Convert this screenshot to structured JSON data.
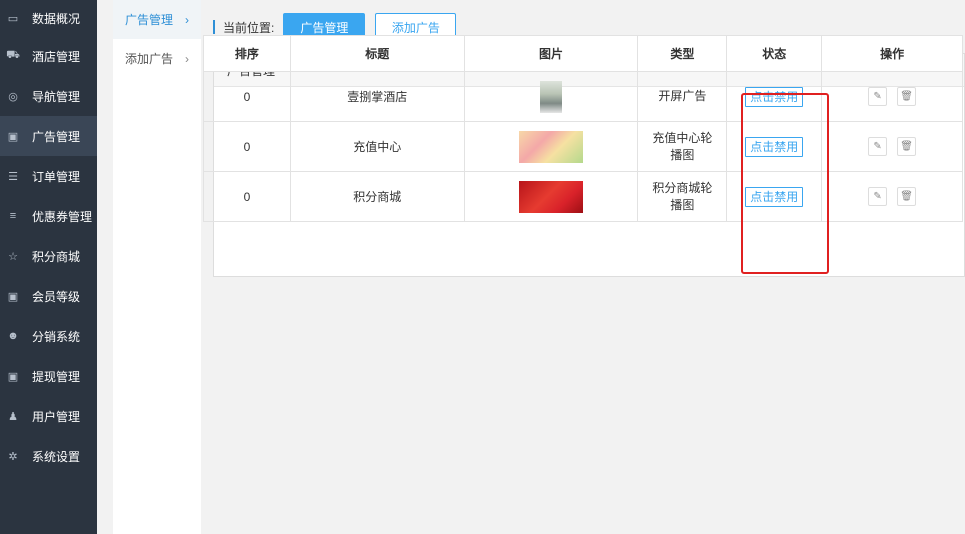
{
  "sidebar": {
    "items": [
      {
        "label": "数据概况",
        "icon": "dashboard-icon",
        "glyph": "▭"
      },
      {
        "label": "酒店管理",
        "icon": "cart-icon",
        "glyph": "⛟"
      },
      {
        "label": "导航管理",
        "icon": "compass-icon",
        "glyph": "◎"
      },
      {
        "label": "广告管理",
        "icon": "gift-icon",
        "glyph": "▣"
      },
      {
        "label": "订单管理",
        "icon": "server-icon",
        "glyph": "☰"
      },
      {
        "label": "优惠券管理",
        "icon": "list-icon",
        "glyph": "≡"
      },
      {
        "label": "积分商城",
        "icon": "star-icon",
        "glyph": "☆"
      },
      {
        "label": "会员等级",
        "icon": "money-icon",
        "glyph": "▣"
      },
      {
        "label": "分销系统",
        "icon": "users-icon",
        "glyph": "☻"
      },
      {
        "label": "提现管理",
        "icon": "cash-icon",
        "glyph": "▣"
      },
      {
        "label": "用户管理",
        "icon": "user-icon",
        "glyph": "♟"
      },
      {
        "label": "系统设置",
        "icon": "gear-icon",
        "glyph": "✲"
      }
    ],
    "active_index": 3
  },
  "submenu": {
    "items": [
      {
        "label": "广告管理"
      },
      {
        "label": "添加广告"
      }
    ]
  },
  "breadcrumb": {
    "label": "当前位置:",
    "current_button": "广告管理",
    "add_button": "添加广告"
  },
  "panel": {
    "title": "广告管理",
    "columns": [
      "排序",
      "标题",
      "图片",
      "类型",
      "状态",
      "操作"
    ],
    "rows": [
      {
        "order": "0",
        "title": "壹捌掌酒店",
        "image": "hotel-photo",
        "type": "开屏广告",
        "status": "点击禁用"
      },
      {
        "order": "0",
        "title": "充值中心",
        "image": "recharge-banner",
        "type": "充值中心轮播图",
        "status": "点击禁用"
      },
      {
        "order": "0",
        "title": "积分商城",
        "image": "points-mall-banner",
        "type": "积分商城轮播图",
        "status": "点击禁用"
      }
    ]
  },
  "colors": {
    "sidebar_bg": "#2b3440",
    "accent": "#3aa6f0",
    "highlight_border": "#e02020"
  }
}
